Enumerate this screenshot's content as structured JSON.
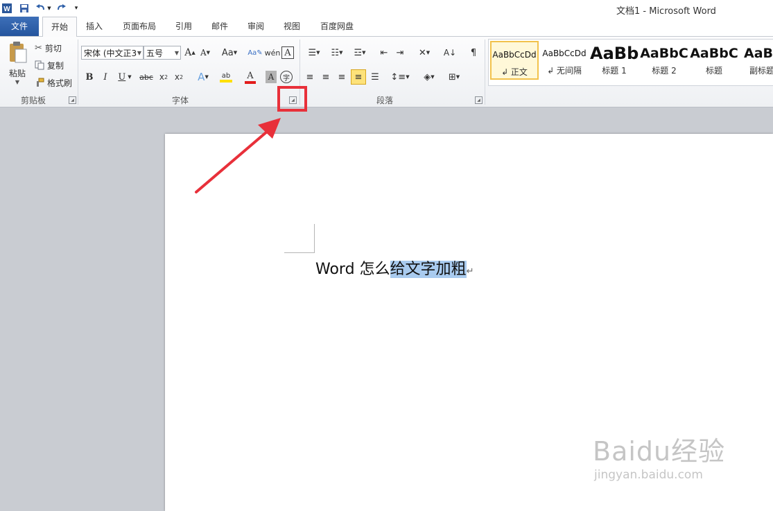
{
  "window": {
    "title": "文档1 - Microsoft Word"
  },
  "tabs": [
    {
      "label": "文件"
    },
    {
      "label": "开始"
    },
    {
      "label": "插入"
    },
    {
      "label": "页面布局"
    },
    {
      "label": "引用"
    },
    {
      "label": "邮件"
    },
    {
      "label": "审阅"
    },
    {
      "label": "视图"
    },
    {
      "label": "百度网盘"
    }
  ],
  "clipboard": {
    "paste": "粘贴",
    "cut": "剪切",
    "copy": "复制",
    "format_painter": "格式刷",
    "group": "剪贴板"
  },
  "font": {
    "name": "宋体 (中文正3",
    "size": "五号",
    "case_label": "Aa",
    "group": "字体"
  },
  "paragraph": {
    "group": "段落"
  },
  "styles": [
    {
      "preview": "AaBbCcDd",
      "name": "↲ 正文"
    },
    {
      "preview": "AaBbCcDd",
      "name": "↲ 无间隔"
    },
    {
      "preview": "AaBb",
      "name": "标题 1"
    },
    {
      "preview": "AaBbC",
      "name": "标题 2"
    },
    {
      "preview": "AaBbC",
      "name": "标题"
    },
    {
      "preview": "AaBb",
      "name": "副标题"
    }
  ],
  "document": {
    "normal_text": "Word 怎么",
    "selected_text": "给文字加粗",
    "para_mark": "↵"
  },
  "watermark": {
    "logo": "Baidu经验",
    "url": "jingyan.baidu.com"
  },
  "colors": {
    "accent": "#2b579a",
    "highlight_red": "#e8303a",
    "selection": "#a9cbef"
  }
}
